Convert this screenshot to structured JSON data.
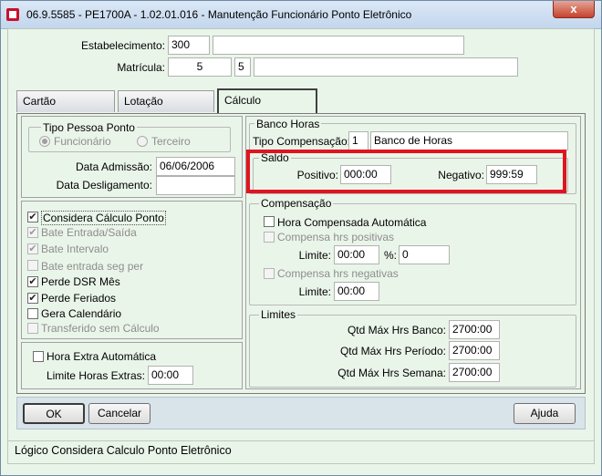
{
  "window": {
    "title": "06.9.5585 - PE1700A - 1.02.01.016 - Manutenção Funcionário Ponto Eletrônico",
    "close_glyph": "x"
  },
  "header": {
    "estabelecimento_label": "Estabelecimento:",
    "estabelecimento_value": "300",
    "estabelecimento_desc": "",
    "matricula_label": "Matrícula:",
    "matricula_value": "5",
    "matricula_value2": "5",
    "matricula_desc": ""
  },
  "tabs": [
    {
      "label": "Cartão"
    },
    {
      "label": "Lotação"
    },
    {
      "label": "Cálculo"
    }
  ],
  "tipo_pessoa": {
    "title": "Tipo Pessoa Ponto",
    "opt1": "Funcionário",
    "opt2": "Terceiro",
    "selected": "Funcionário"
  },
  "datas": {
    "admissao_label": "Data Admissão:",
    "admissao_value": "06/06/2006",
    "desligamento_label": "Data Desligamento:",
    "desligamento_value": ""
  },
  "options": [
    {
      "label": "Considera Cálculo Ponto",
      "checked": true,
      "enabled": true
    },
    {
      "label": "Bate Entrada/Saída",
      "checked": true,
      "enabled": false
    },
    {
      "label": "Bate Intervalo",
      "checked": true,
      "enabled": false
    },
    {
      "label": "Bate entrada seg per",
      "checked": false,
      "enabled": false
    },
    {
      "label": "Perde DSR Mês",
      "checked": true,
      "enabled": true
    },
    {
      "label": "Perde Feriados",
      "checked": true,
      "enabled": true
    },
    {
      "label": "Gera Calendário",
      "checked": false,
      "enabled": true
    },
    {
      "label": "Transferido sem Cálculo",
      "checked": false,
      "enabled": false
    }
  ],
  "hora_extra": {
    "label": "Hora Extra Automática",
    "checked": false,
    "limite_label": "Limite Horas Extras:",
    "limite_value": "00:00"
  },
  "banco_horas": {
    "title": "Banco Horas",
    "tipo_label": "Tipo Compensação:",
    "tipo_code": "1",
    "tipo_desc": "Banco de Horas"
  },
  "saldo": {
    "title": "Saldo",
    "positivo_label": "Positivo:",
    "positivo_value": "000:00",
    "negativo_label": "Negativo:",
    "negativo_value": "999:59",
    "highlight_color": "#e0141f"
  },
  "compensacao": {
    "title": "Compensação",
    "hora_comp_label": "Hora Compensada Automática",
    "positivas_label": "Compensa hrs positivas",
    "limite_label": "Limite:",
    "limite1_value": "00:00",
    "pct_label": "%:",
    "pct_value": "0",
    "negativas_label": "Compensa hrs negativas",
    "limite2_value": "00:00"
  },
  "limites": {
    "title": "Limites",
    "banco_label": "Qtd Máx Hrs Banco:",
    "banco_value": "2700:00",
    "periodo_label": "Qtd Máx Hrs Período:",
    "periodo_value": "2700:00",
    "semana_label": "Qtd Máx Hrs Semana:",
    "semana_value": "2700:00"
  },
  "buttons": {
    "ok": "OK",
    "cancelar": "Cancelar",
    "ajuda": "Ajuda"
  },
  "status": {
    "text": "Lógico Considera Calculo Ponto Eletrônico"
  },
  "icons": {
    "check": "✔",
    "app": "app-icon"
  }
}
